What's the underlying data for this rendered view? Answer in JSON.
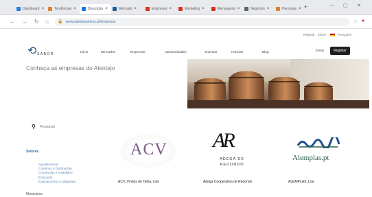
{
  "browser": {
    "tabs": [
      {
        "label": "Dashboard",
        "color": "#2d7be5"
      },
      {
        "label": "Tendências",
        "color": "#d9822b"
      },
      {
        "label": "Descrição",
        "color": "#1a73e8"
      },
      {
        "label": "Mercado",
        "color": "#1c5d99"
      },
      {
        "label": "Empresas",
        "color": "#d93025"
      },
      {
        "label": "Marketing",
        "color": "#d93025"
      },
      {
        "label": "Mensagens",
        "color": "#d93025"
      },
      {
        "label": "Negócios",
        "color": "#5f6368"
      },
      {
        "label": "Parcerias",
        "color": "#d9822b"
      }
    ],
    "new_tab": "+",
    "url": "www.saborbusiness.pt/empresas",
    "minimize": "—",
    "restore": "▢",
    "close": "✕"
  },
  "site": {
    "top_links": "Registar  ·  Entrar",
    "language": "Português",
    "logo_word": "SABOR",
    "menu": [
      "Início",
      "Mercados",
      "Empresas",
      "Oportunidades",
      "Eventos",
      "Notícias",
      "Blog"
    ],
    "enter": "Entrar",
    "register": "Registar",
    "hero_text": "Conheça as empresas do Alentejo"
  },
  "search": {
    "placeholder": "Pesquisar"
  },
  "filters": {
    "heading": "Setores",
    "items": [
      "Agroalimentar",
      "Comércio e Distribuição",
      "Construção e Imobiliário",
      "Educação",
      "Equipamentos e Máquinas"
    ],
    "heading2": "Municípios"
  },
  "companies": [
    {
      "name": "ACV, Vinhos de Talha, Lda",
      "logo_text": "ACV"
    },
    {
      "name": "Adega Cooperativa de Redondo",
      "logo_text": "AR",
      "logo_sub": "ADEGA DE REDONDO"
    },
    {
      "name": "ALEMPLAS, Lda",
      "logo_text": "Alemplas.pt"
    }
  ]
}
